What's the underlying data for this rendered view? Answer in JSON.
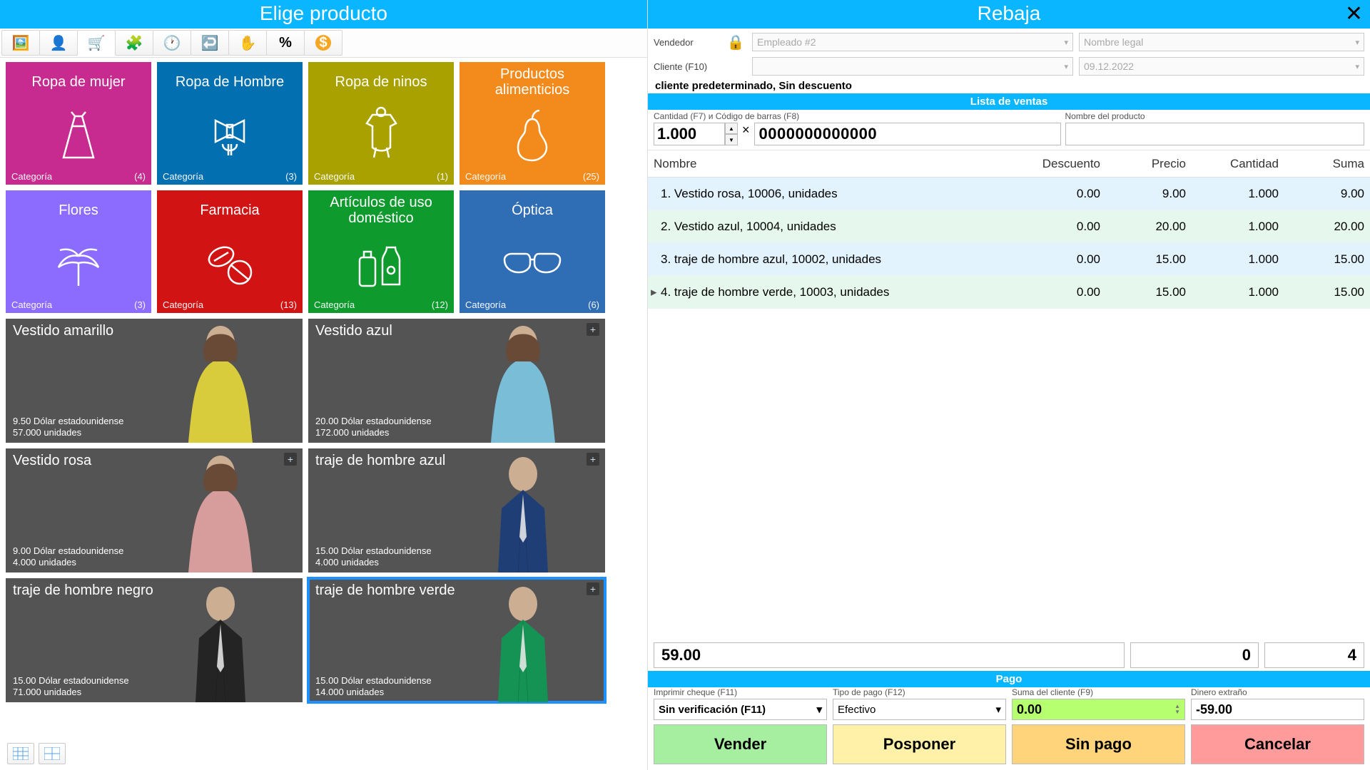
{
  "left": {
    "title": "Elige producto",
    "toolbar": [
      "picture",
      "user",
      "cart",
      "puzzle",
      "clock",
      "undo",
      "hand",
      "percent",
      "dollar"
    ],
    "categories": [
      {
        "name": "Ropa de mujer",
        "meta": "Categoría",
        "count": "(4)",
        "color": "#c72b8f",
        "icon": "dress"
      },
      {
        "name": "Ropa de Hombre",
        "meta": "Categoría",
        "count": "(3)",
        "color": "#026fb1",
        "icon": "bowtie"
      },
      {
        "name": "Ropa de ninos",
        "meta": "Categoría",
        "count": "(1)",
        "color": "#a8a100",
        "icon": "onesie"
      },
      {
        "name": "Productos alimenticios",
        "meta": "Categoría",
        "count": "(25)",
        "color": "#f28a1c",
        "icon": "pear"
      },
      {
        "name": "Flores",
        "meta": "Categoría",
        "count": "(3)",
        "color": "#8c6cff",
        "icon": "palm"
      },
      {
        "name": "Farmacia",
        "meta": "Categoría",
        "count": "(13)",
        "color": "#d11313",
        "icon": "pill"
      },
      {
        "name": "Artículos de uso doméstico",
        "meta": "Categoría",
        "count": "(12)",
        "color": "#0f9a2e",
        "icon": "bottles"
      },
      {
        "name": "Óptica",
        "meta": "Categoría",
        "count": "(6)",
        "color": "#2f6db5",
        "icon": "glasses"
      }
    ],
    "products": [
      {
        "name": "Vestido amarillo",
        "price": "9.50 Dólar estadounidense",
        "stock": "57.000 unidades",
        "plus": false,
        "color": "#e8d93a"
      },
      {
        "name": "Vestido azul",
        "price": "20.00 Dólar estadounidense",
        "stock": "172.000 unidades",
        "plus": true,
        "color": "#7ec9e6"
      },
      {
        "name": "Vestido rosa",
        "price": "9.00 Dólar estadounidense",
        "stock": "4.000 unidades",
        "plus": true,
        "color": "#e6a6a6"
      },
      {
        "name": "traje de hombre azul",
        "price": "15.00 Dólar estadounidense",
        "stock": "4.000 unidades",
        "plus": true,
        "color": "#1b3c7a"
      },
      {
        "name": "traje de hombre negro",
        "price": "15.00 Dólar estadounidense",
        "stock": "71.000 unidades",
        "plus": false,
        "color": "#1f1f1f"
      },
      {
        "name": "traje de hombre verde",
        "price": "15.00 Dólar estadounidense",
        "stock": "14.000 unidades",
        "plus": true,
        "color": "#0f9a55",
        "selected": true
      }
    ]
  },
  "right": {
    "title": "Rebaja",
    "vendor_label": "Vendedor",
    "vendor_value": "Empleado #2",
    "legal_placeholder": "Nombre legal",
    "client_label": "Cliente (F10)",
    "date_value": "09.12.2022",
    "client_line": "cliente predeterminado, Sin descuento",
    "list_band": "Lista de ventas",
    "qty_label": "Cantidad (F7) и Código de barras (F8)",
    "qty_value": "1.000",
    "barcode_value": "0000000000000",
    "pname_label": "Nombre del producto",
    "columns": {
      "name": "Nombre",
      "disc": "Descuento",
      "price": "Precio",
      "qty": "Cantidad",
      "sum": "Suma"
    },
    "rows": [
      {
        "n": "1. Vestido rosa, 10006, unidades",
        "d": "0.00",
        "p": "9.00",
        "q": "1.000",
        "s": "9.00",
        "cls": "blue"
      },
      {
        "n": "2. Vestido azul, 10004, unidades",
        "d": "0.00",
        "p": "20.00",
        "q": "1.000",
        "s": "20.00",
        "cls": "green"
      },
      {
        "n": "3. traje de hombre azul, 10002, unidades",
        "d": "0.00",
        "p": "15.00",
        "q": "1.000",
        "s": "15.00",
        "cls": "blue"
      },
      {
        "n": "4. traje de hombre verde, 10003, unidades",
        "d": "0.00",
        "p": "15.00",
        "q": "1.000",
        "s": "15.00",
        "cls": "green",
        "arrow": true
      }
    ],
    "totals": {
      "sum": "59.00",
      "disc": "0",
      "count": "4"
    },
    "pay_band": "Pago",
    "print_label": "Imprimir cheque (F11)",
    "print_value": "Sin verificación (F11)",
    "type_label": "Tipo de pago (F12)",
    "type_value": "Efectivo",
    "client_sum_label": "Suma del cliente (F9)",
    "client_sum_value": "0.00",
    "change_label": "Dinero extraño",
    "change_value": "-59.00",
    "buttons": {
      "sell": "Vender",
      "post": "Posponer",
      "nopay": "Sin pago",
      "cancel": "Cancelar"
    }
  }
}
